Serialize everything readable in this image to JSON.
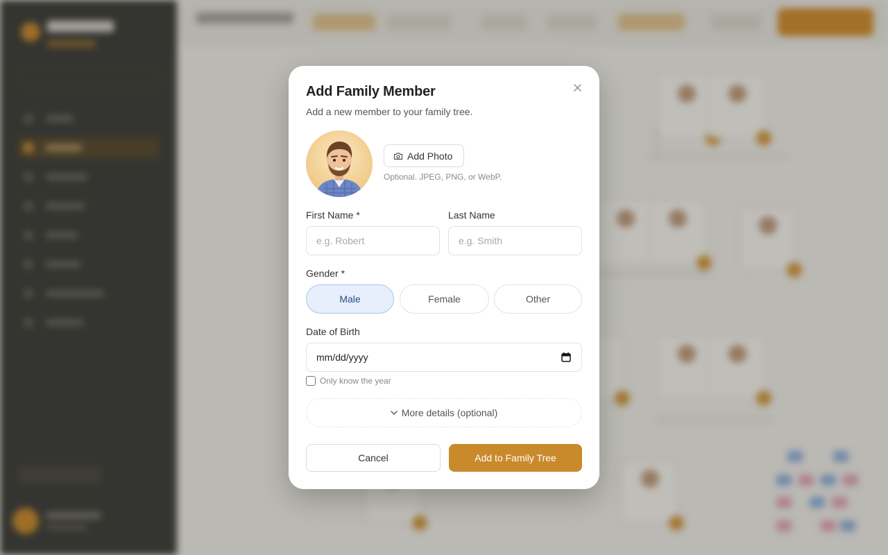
{
  "modal": {
    "title": "Add Family Member",
    "subtitle": "Add a new member to your family tree.",
    "close_icon": "close-icon",
    "photo": {
      "button_label": "Add Photo",
      "button_icon": "camera-icon",
      "hint": "Optional. JPEG, PNG, or WebP."
    },
    "first_name": {
      "label": "First Name *",
      "value": "",
      "placeholder": "e.g. Robert"
    },
    "last_name": {
      "label": "Last Name",
      "value": "",
      "placeholder": "e.g. Smith"
    },
    "gender": {
      "label": "Gender *",
      "options": [
        "Male",
        "Female",
        "Other"
      ],
      "selected": "Male"
    },
    "date_of_birth": {
      "label": "Date of Birth",
      "value": "mm/dd/yyyy",
      "icon": "calendar-icon"
    },
    "year_only": {
      "label": "Only know the year",
      "checked": false
    },
    "more_details": {
      "label": "More details (optional)",
      "icon": "chevron-down-icon"
    },
    "actions": {
      "cancel": "Cancel",
      "submit": "Add to Family Tree"
    }
  },
  "colors": {
    "accent": "#c98a2c",
    "selected_bg": "#e6effb",
    "selected_border": "#a9c4ea",
    "sidebar_bg": "#3a3a36"
  }
}
